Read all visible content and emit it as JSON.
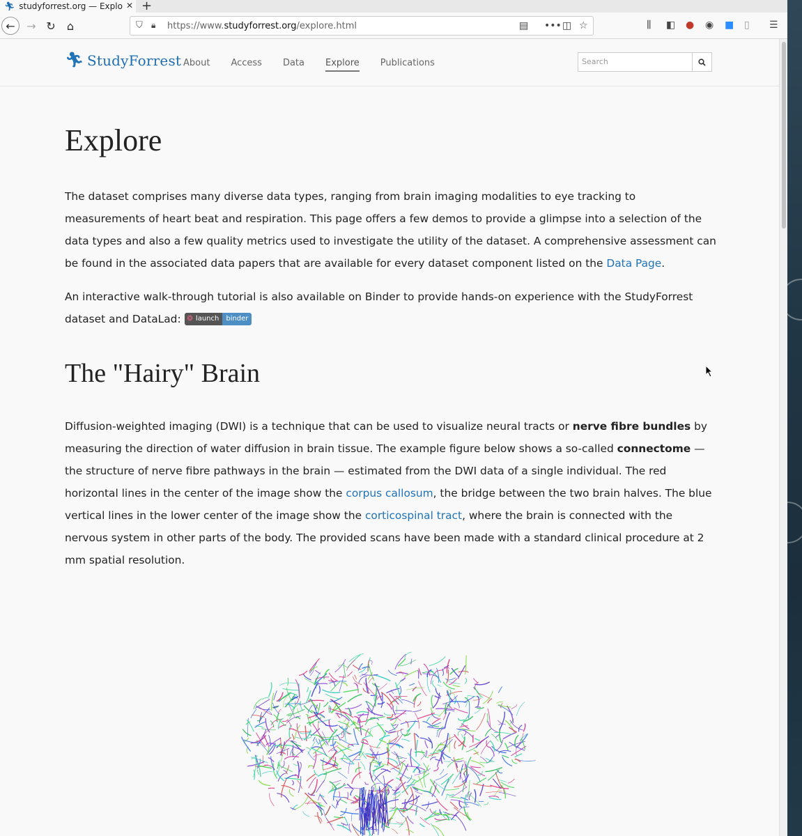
{
  "browser": {
    "tab_title": "studyforrest.org — Explore",
    "url_prefix": "https://www.",
    "url_domain": "studyforrest.org",
    "url_path": "/explore.html"
  },
  "site": {
    "brand": "StudyForrest",
    "nav": [
      {
        "label": "About"
      },
      {
        "label": "Access"
      },
      {
        "label": "Data"
      },
      {
        "label": "Explore"
      },
      {
        "label": "Publications"
      }
    ],
    "search_placeholder": "Search"
  },
  "content": {
    "title": "Explore",
    "p1_text": "The dataset comprises many diverse data types, ranging from brain imaging modalities to eye tracking to measurements of heart beat and respiration. This page offers a few demos to provide a glimpse into a selection of the data types and also a few quality metrics used to investigate the utility of the dataset. A comprehensive assessment can be found in the associated data papers that are available for every dataset component listed on the ",
    "p1_link": "Data Page",
    "p1_end": ".",
    "p2_text": "An interactive walk-through tutorial is also available on Binder to provide hands-on experience with the StudyForrest dataset and DataLad: ",
    "binder_left": "launch",
    "binder_right": "binder",
    "section_title": "The \"Hairy\" Brain",
    "p3_a": "Diffusion-weighted imaging (DWI) is a technique that can be used to visualize neural tracts or ",
    "p3_bold1": "nerve fibre bundles",
    "p3_b": " by measuring the direction of water diffusion in brain tissue. The example figure below shows a so-called ",
    "p3_bold2": "connectome",
    "p3_c": " — the structure of nerve fibre pathways in the brain — estimated from the DWI data of a single individual. The red horizontal lines in the center of the image show the ",
    "p3_link1": "corpus callosum",
    "p3_d": ", the bridge between the two brain halves. The blue vertical lines in the lower center of the image show the ",
    "p3_link2": "corticospinal tract",
    "p3_e": ", where the brain is connected with the nervous system in other parts of the body. The provided scans have been made with a standard clinical procedure at 2 mm spatial resolution."
  },
  "colors": {
    "link": "#1f73b7",
    "brand": "#1f6eb3"
  }
}
